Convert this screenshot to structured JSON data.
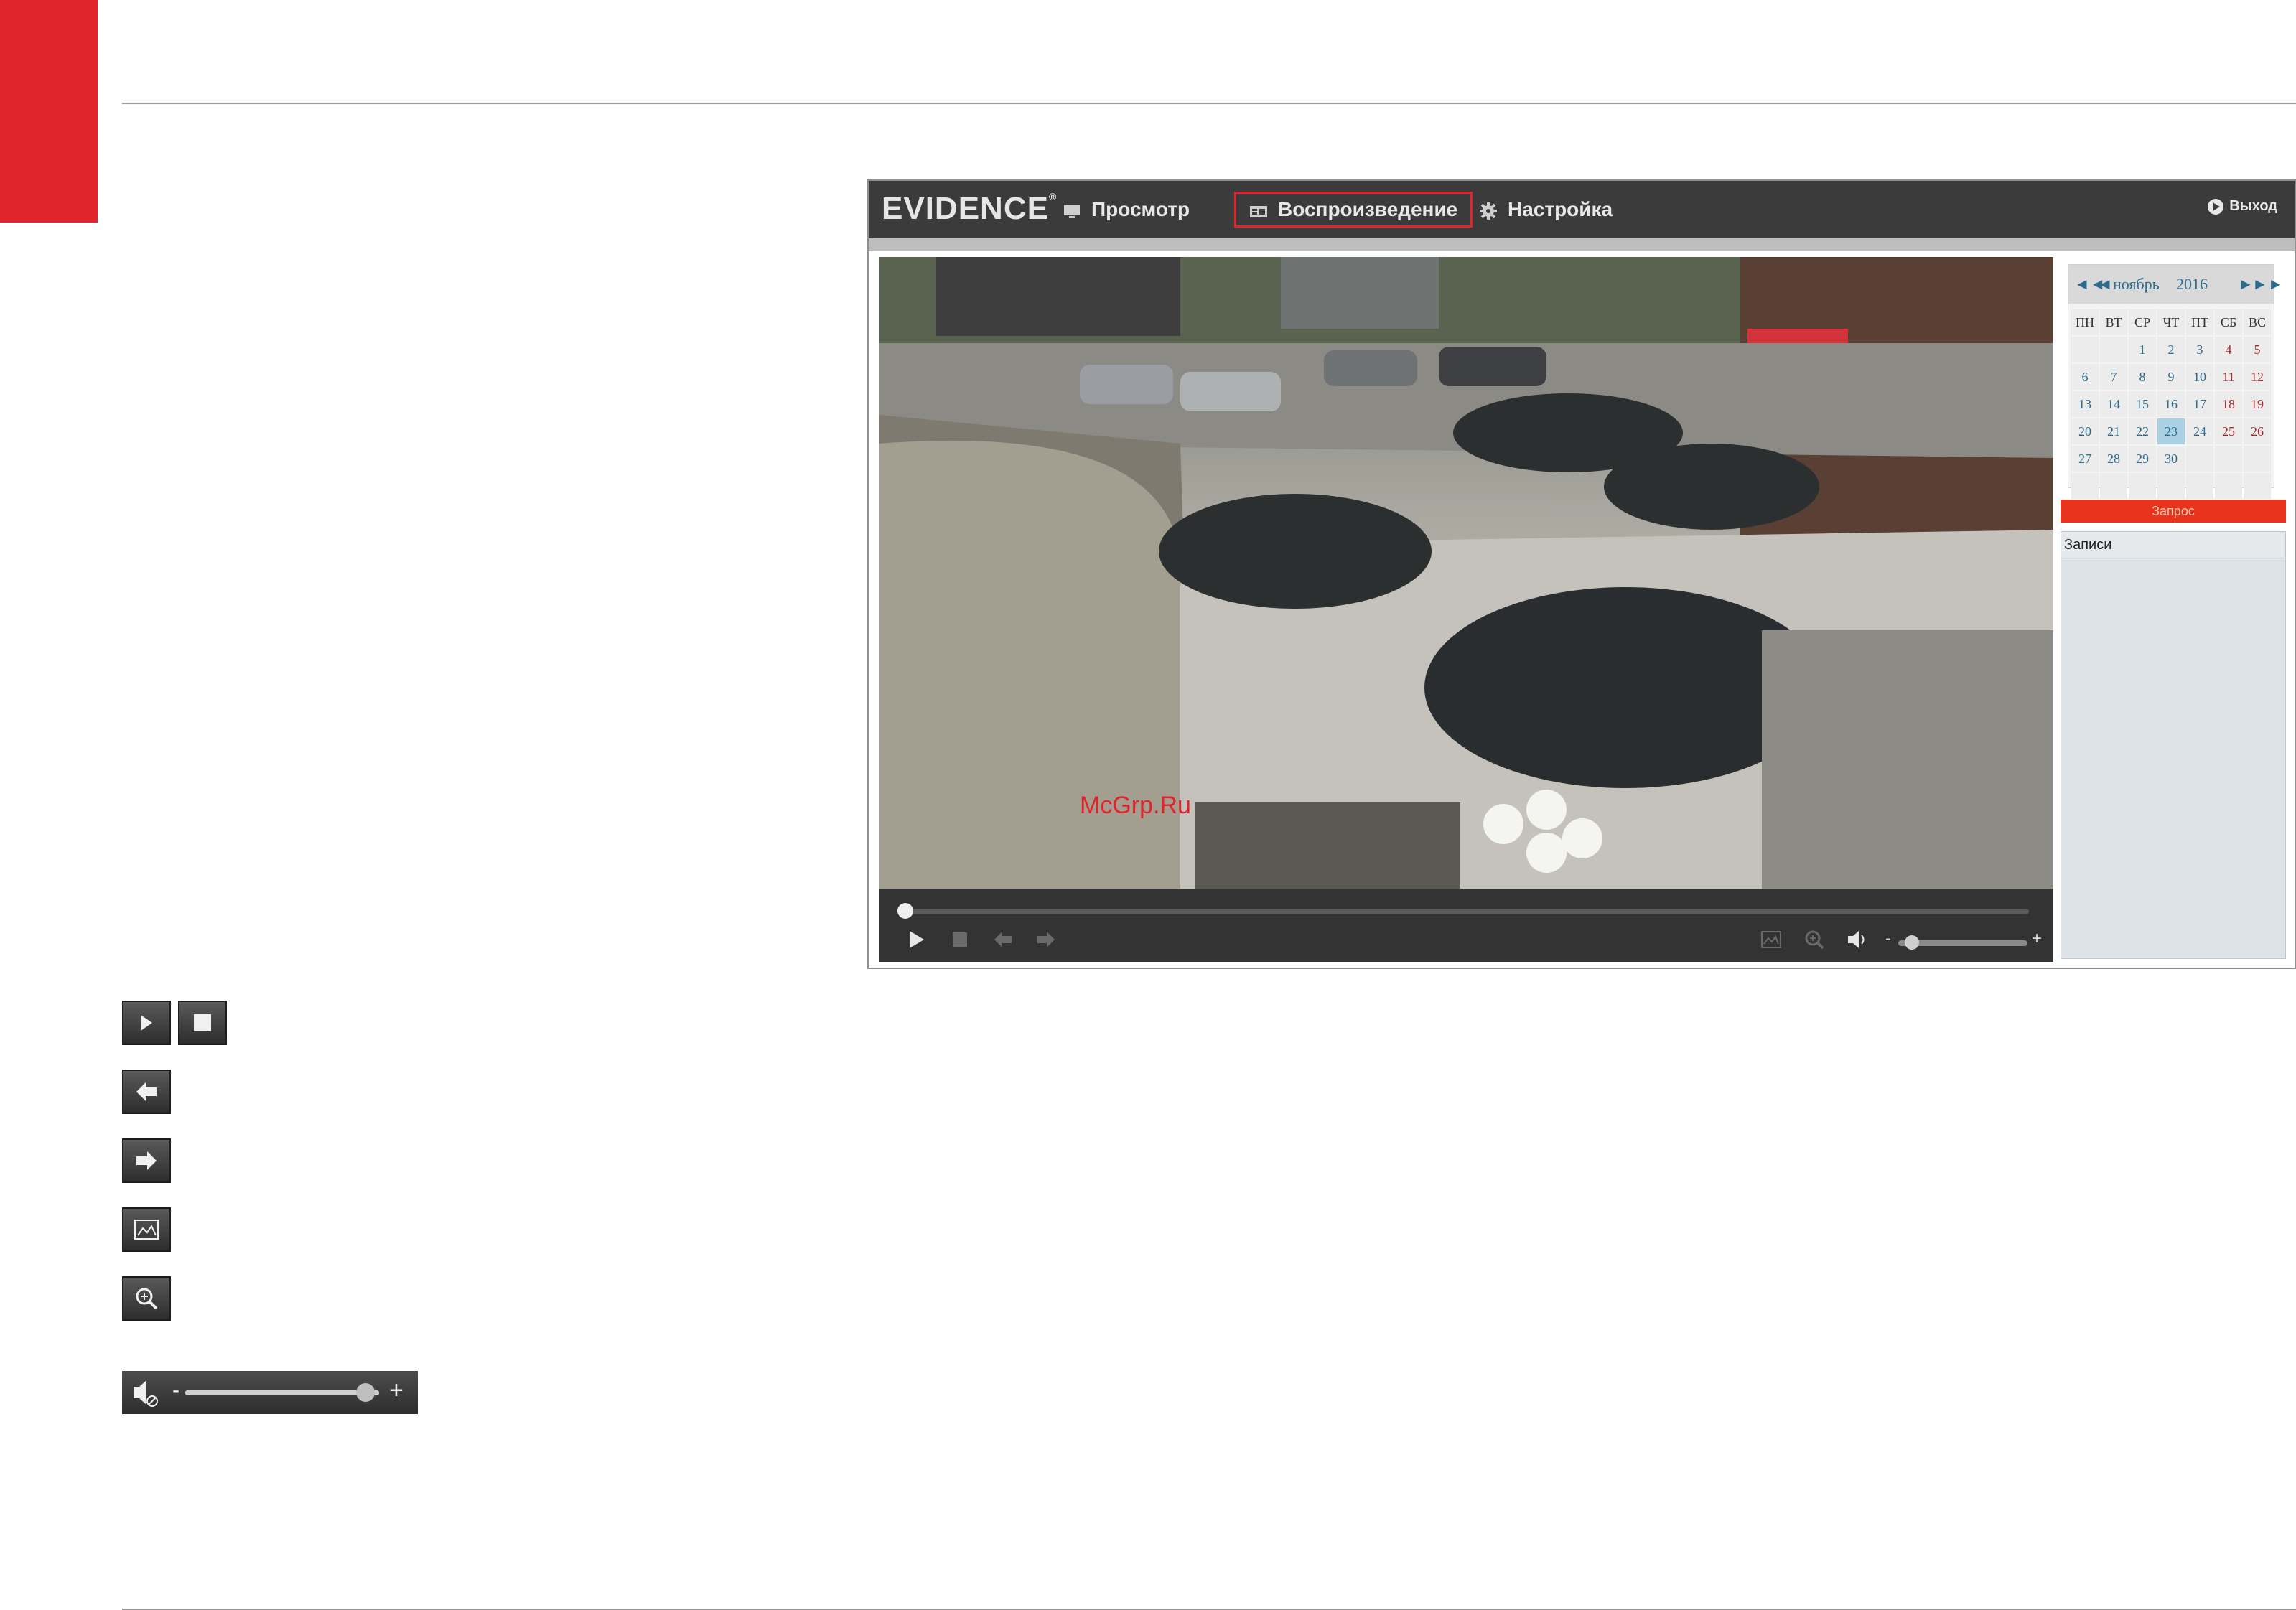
{
  "app": {
    "logo": "EVIDENCE",
    "logo_mark": "®",
    "nav": [
      {
        "label": "Просмотр",
        "icon": "monitor-icon"
      },
      {
        "label": "Воспроизведение",
        "icon": "playback-icon",
        "active": true
      },
      {
        "label": "Настройка",
        "icon": "gear-icon"
      }
    ],
    "exit_label": "Выход",
    "watermark": "McGrp.Ru",
    "calendar": {
      "month": "ноябрь",
      "year": "2016",
      "weekdays": [
        "ПН",
        "ВТ",
        "СР",
        "ЧТ",
        "ПТ",
        "СБ",
        "ВС"
      ],
      "selected_day": 23,
      "weeks": [
        [
          "",
          "",
          1,
          2,
          3,
          4,
          5
        ],
        [
          6,
          7,
          8,
          9,
          10,
          11,
          12
        ],
        [
          13,
          14,
          15,
          16,
          17,
          18,
          19
        ],
        [
          20,
          21,
          22,
          23,
          24,
          25,
          26
        ],
        [
          27,
          28,
          29,
          30,
          "",
          "",
          ""
        ],
        [
          "",
          "",
          "",
          "",
          "",
          "",
          ""
        ]
      ]
    },
    "query_button": "Запрос",
    "records_title": "Записи",
    "volume": {
      "minus": "-",
      "plus": "+",
      "level": 0.05
    },
    "progress": 0.0
  },
  "legend": {
    "volume": {
      "minus": "-",
      "plus": "+",
      "level": 0.93
    }
  },
  "colors": {
    "accent": "#e0242b",
    "header": "#3b3b3b",
    "query": "#e8341c"
  }
}
